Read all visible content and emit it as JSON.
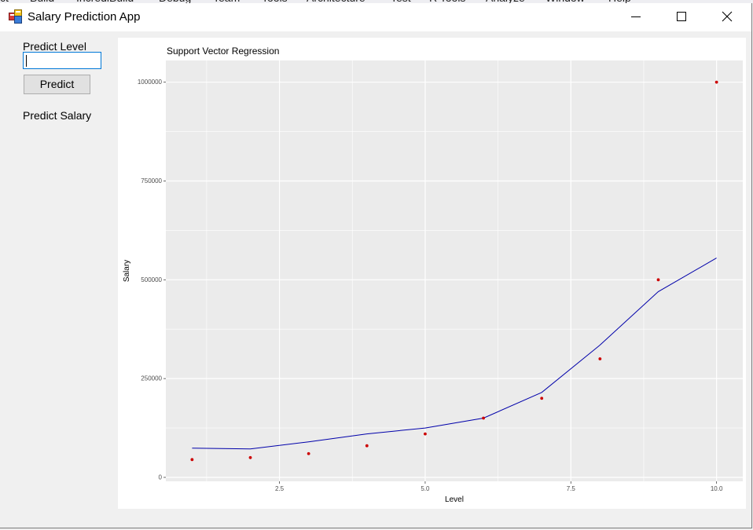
{
  "background_menu": [
    "ct",
    "Build",
    "IncrediBuild",
    "Debug",
    "Team",
    "Tools",
    "Architecture",
    "Test",
    "R Tools",
    "Analyze",
    "Window",
    "Help"
  ],
  "window": {
    "title": "Salary Prediction App"
  },
  "form": {
    "predict_level_label": "Predict Level",
    "level_input_value": "",
    "predict_button_label": "Predict",
    "predict_salary_label": "Predict Salary"
  },
  "colors": {
    "points": "#cc0000",
    "line": "#0000aa",
    "panel": "#ebebeb",
    "grid": "#ffffff"
  },
  "chart_data": {
    "type": "scatter",
    "title": "Support Vector Regression",
    "xlabel": "Level",
    "ylabel": "Salary",
    "xlim": [
      0.55,
      10.45
    ],
    "ylim": [
      -10000,
      1055000
    ],
    "x_ticks": [
      2.5,
      5.0,
      7.5,
      10.0
    ],
    "x_tick_labels": [
      "2.5",
      "5.0",
      "7.5",
      "10.0"
    ],
    "y_ticks": [
      0,
      250000,
      500000,
      750000,
      1000000
    ],
    "y_tick_labels": [
      "0",
      "250000",
      "500000",
      "750000",
      "1000000"
    ],
    "grid": true,
    "series": [
      {
        "type": "scatter",
        "x": [
          1,
          2,
          3,
          4,
          5,
          6,
          7,
          8,
          9,
          10
        ],
        "y": [
          45000,
          50000,
          60000,
          80000,
          110000,
          150000,
          200000,
          300000,
          500000,
          1000000
        ]
      },
      {
        "type": "line",
        "x": [
          1,
          2,
          3,
          4,
          5,
          6,
          7,
          8,
          9,
          10
        ],
        "y": [
          74000,
          72000,
          90000,
          110000,
          125000,
          150000,
          215000,
          335000,
          470000,
          555000
        ]
      }
    ]
  }
}
